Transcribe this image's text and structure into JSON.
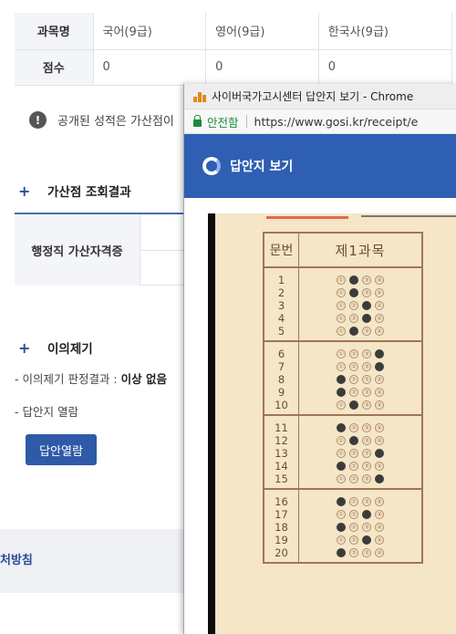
{
  "score_table": {
    "header_label": "과목명",
    "subjects": [
      "국어(9급)",
      "영어(9급)",
      "한국사(9급)"
    ],
    "score_label": "점수",
    "scores": [
      "0",
      "0",
      "0"
    ]
  },
  "notice": {
    "icon": "exclamation-circle-icon",
    "text": "공개된 성적은 가산점이"
  },
  "bonus_section": {
    "title": "가산점 조회결과",
    "row_label": "행정직 가산자격증"
  },
  "objection_section": {
    "title": "이의제기",
    "result_prefix": "- 이의제기 판정결과 : ",
    "result_value": "이상 없음",
    "view_label": "- 답안지 열람",
    "button_label": "답안열람"
  },
  "footer": {
    "text": "처방침"
  },
  "popup": {
    "window_title": "사이버국가고시센터 답안지 보기 - Chrome",
    "secure_label": "안전함",
    "url": "https://www.gosi.kr/receipt/e",
    "header_title": "답안지 보기",
    "sheet": {
      "col_number": "문번",
      "col_subject": "제1과목",
      "marks": [
        "①",
        "②",
        "③",
        "④"
      ],
      "groups": [
        {
          "numbers": [
            "1",
            "2",
            "3",
            "4",
            "5"
          ],
          "answers": [
            2,
            2,
            3,
            3,
            2
          ]
        },
        {
          "numbers": [
            "6",
            "7",
            "8",
            "9",
            "10"
          ],
          "answers": [
            4,
            4,
            1,
            1,
            2
          ]
        },
        {
          "numbers": [
            "11",
            "12",
            "13",
            "14",
            "15"
          ],
          "answers": [
            1,
            2,
            4,
            1,
            4
          ]
        },
        {
          "numbers": [
            "16",
            "17",
            "18",
            "19",
            "20"
          ],
          "answers": [
            1,
            3,
            1,
            3,
            1
          ]
        }
      ]
    }
  },
  "colors": {
    "accent_blue": "#2e5fb3",
    "button_blue": "#2f5aa8",
    "sheet_bg": "#f4e6c6",
    "sheet_line": "#a1755a"
  }
}
